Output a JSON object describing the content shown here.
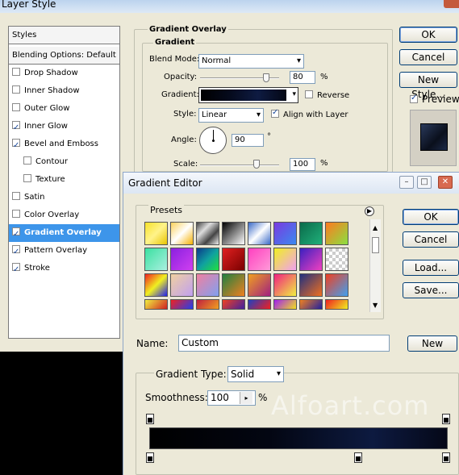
{
  "layer_style": {
    "title": "Layer Style",
    "styles_header": "Styles",
    "blending_options": "Blending Options: Default",
    "items": [
      {
        "label": "Drop Shadow",
        "checked": false
      },
      {
        "label": "Inner Shadow",
        "checked": false
      },
      {
        "label": "Outer Glow",
        "checked": false
      },
      {
        "label": "Inner Glow",
        "checked": true
      },
      {
        "label": "Bevel and Emboss",
        "checked": true
      },
      {
        "label": "Contour",
        "checked": false
      },
      {
        "label": "Texture",
        "checked": false
      },
      {
        "label": "Satin",
        "checked": false
      },
      {
        "label": "Color Overlay",
        "checked": false
      },
      {
        "label": "Gradient Overlay",
        "checked": true
      },
      {
        "label": "Pattern Overlay",
        "checked": true
      },
      {
        "label": "Stroke",
        "checked": true
      }
    ],
    "section_title": "Gradient Overlay",
    "group_title": "Gradient",
    "blend_mode_label": "Blend Mode:",
    "blend_mode_value": "Normal",
    "opacity_label": "Opacity:",
    "opacity_value": "80",
    "opacity_unit": "%",
    "gradient_label": "Gradient:",
    "reverse_label": "Reverse",
    "style_label": "Style:",
    "style_value": "Linear",
    "align_label": "Align with Layer",
    "angle_label": "Angle:",
    "angle_value": "90",
    "angle_unit": "°",
    "scale_label": "Scale:",
    "scale_value": "100",
    "scale_unit": "%",
    "ok": "OK",
    "cancel": "Cancel",
    "new_style": "New Style...",
    "preview": "Preview",
    "opacity_fraction": 0.8,
    "scale_fraction": 0.67
  },
  "gradient_editor": {
    "title": "Gradient Editor",
    "presets_label": "Presets",
    "ok": "OK",
    "cancel": "Cancel",
    "load": "Load...",
    "save": "Save...",
    "name_label": "Name:",
    "name_value": "Custom",
    "new": "New",
    "type_label": "Gradient Type:",
    "type_value": "Solid",
    "smoothness_label": "Smoothness:",
    "smoothness_value": "100",
    "smoothness_unit": "%",
    "colors": {
      "bar_start": "#000000",
      "bar_mid": "#0d1a40",
      "bar_end": "#050818"
    }
  },
  "watermark": "Alfoart.com"
}
